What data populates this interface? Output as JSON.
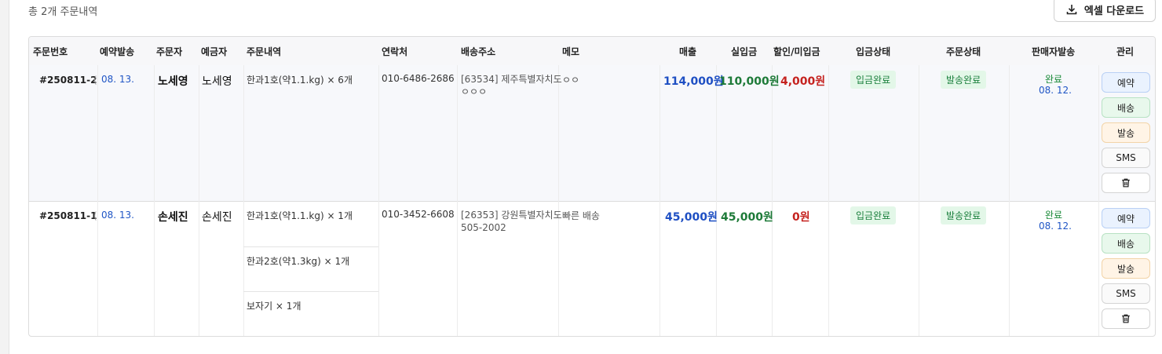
{
  "summary": {
    "total_text": "총 2개 주문내역"
  },
  "toolbar": {
    "excel_label": "엑셀 다운로드",
    "excel_icon": "download-icon"
  },
  "table": {
    "headers": {
      "order_no": "주문번호",
      "reserved_ship": "예약발송",
      "orderer": "주문자",
      "depositor": "예금자",
      "items": "주문내역",
      "contact": "연락처",
      "address": "배송주소",
      "memo": "메모",
      "sales": "매출",
      "paid": "실입금",
      "discount": "할인/미입금",
      "payment_status": "입금상태",
      "order_status": "주문상태",
      "seller_ship": "판매자발송",
      "manage": "관리"
    },
    "rows": [
      {
        "order_no": "#250811-2",
        "reserved_ship": "08. 13.",
        "orderer": "노세영",
        "depositor": "노세영",
        "items": [
          "한과1호(약1.1.kg) × 6개"
        ],
        "contact": "010-6486-2686",
        "address_line1": "[63534] 제주특별자치도",
        "address_line2": "ㅇㅇㅇ",
        "memo": "ㅇㅇ",
        "sales": "114,000원",
        "paid": "110,000원",
        "discount": "4,000원",
        "payment_status": "입금완료",
        "order_status": "발송완료",
        "seller_status": "완료",
        "seller_date": "08. 12."
      },
      {
        "order_no": "#250811-1",
        "reserved_ship": "08. 13.",
        "orderer": "손세진",
        "depositor": "손세진",
        "items": [
          "한과1호(약1.1.kg) × 1개",
          "한과2호(약1.3kg) × 1개",
          "보자기 × 1개"
        ],
        "contact": "010-3452-6608",
        "address_line1": "[26353] 강원특별자치도",
        "address_line2": "505-2002",
        "memo": "빠른 배송",
        "sales": "45,000원",
        "paid": "45,000원",
        "discount": "0원",
        "payment_status": "입금완료",
        "order_status": "발송완료",
        "seller_status": "완료",
        "seller_date": "08. 12."
      }
    ]
  },
  "actions": {
    "reserve": "예약",
    "ship": "배송",
    "send": "발송",
    "sms": "SMS",
    "delete_icon": "trash-icon"
  }
}
